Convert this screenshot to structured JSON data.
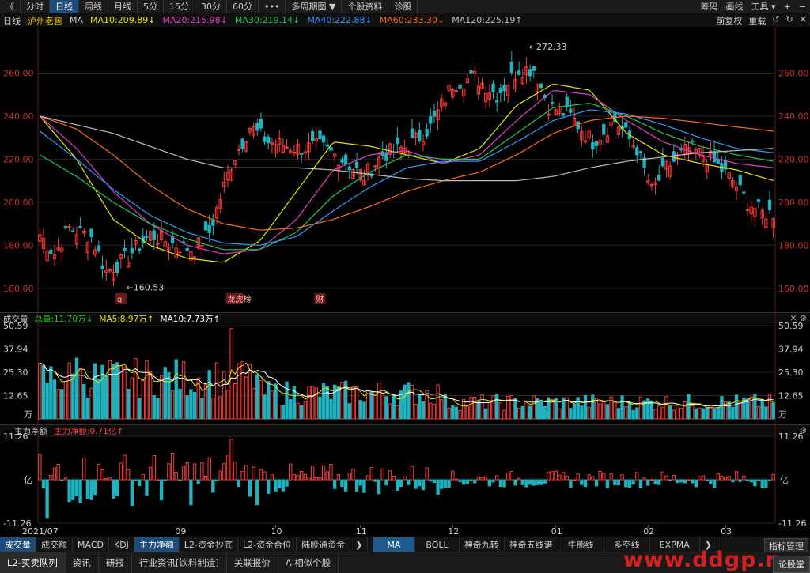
{
  "toolbar": {
    "back": "《",
    "tabs": [
      "分时",
      "日线",
      "周线",
      "月线",
      "5分",
      "15分",
      "30分",
      "60分",
      "•••",
      "多周期图 ▼",
      "个股资料",
      "诊股"
    ],
    "active_tab": 1,
    "right": [
      "筹码",
      "画线",
      "工具 ▾",
      "+",
      "−"
    ]
  },
  "ma_header": {
    "period": "日线",
    "stock": "泸州老窖",
    "ma_label": "MA",
    "items": [
      {
        "text": "MA10:209.89↓",
        "color": "#e6e600"
      },
      {
        "text": "MA20:215.98↓",
        "color": "#e040c0"
      },
      {
        "text": "MA30:219.14↓",
        "color": "#22c55e"
      },
      {
        "text": "MA40:222.88↓",
        "color": "#3399ff"
      },
      {
        "text": "MA60:233.30↓",
        "color": "#ff6a1a"
      },
      {
        "text": "MA120:225.19↑",
        "color": "#bdbdbd"
      }
    ],
    "right": [
      "前复权",
      "重载",
      "↺",
      "↻",
      "✕"
    ]
  },
  "volume_header": {
    "title": "成交量",
    "items": [
      {
        "text": "总量:11.70万↓",
        "color": "#22cc22"
      },
      {
        "text": "MA5:8.97万↑",
        "color": "#e6e600"
      },
      {
        "text": "MA10:7.73万↑",
        "color": "#ffffff"
      }
    ]
  },
  "flow_header": {
    "title": "主力净额",
    "items": [
      {
        "text": "主力净额:0.71亿↑",
        "color": "#ff4040"
      }
    ]
  },
  "chart_data": {
    "type": "candlestick",
    "title": "泸州老窖",
    "price_axis": {
      "ticks": [
        "260.00",
        "240.00",
        "220.00",
        "200.00",
        "180.00",
        "160.00"
      ],
      "ylim": [
        150,
        280
      ]
    },
    "annotations": [
      {
        "label": "272.33"
      },
      {
        "label": "160.53"
      }
    ],
    "event_marks": [
      "q",
      "龙虎榜",
      "财"
    ],
    "x_labels": [
      "2021/07",
      "09",
      "10",
      "11",
      "12",
      "01",
      "02",
      "03"
    ],
    "volume_axis": {
      "ticks": [
        "50.59",
        "37.94",
        "25.30",
        "12.65"
      ],
      "unit": "万"
    },
    "flow_axis": {
      "ticks": [
        "11.26",
        "-11.26"
      ],
      "unit": "亿"
    },
    "price_keypoints": [
      {
        "i": 0,
        "p": 185
      },
      {
        "i": 4,
        "p": 176
      },
      {
        "i": 8,
        "p": 188
      },
      {
        "i": 14,
        "p": 184
      },
      {
        "i": 18,
        "p": 168
      },
      {
        "i": 22,
        "p": 172
      },
      {
        "i": 30,
        "p": 185
      },
      {
        "i": 37,
        "p": 180
      },
      {
        "i": 42,
        "p": 178
      },
      {
        "i": 46,
        "p": 186
      },
      {
        "i": 52,
        "p": 218
      },
      {
        "i": 57,
        "p": 235
      },
      {
        "i": 62,
        "p": 228
      },
      {
        "i": 70,
        "p": 225
      },
      {
        "i": 76,
        "p": 226
      },
      {
        "i": 82,
        "p": 220
      },
      {
        "i": 88,
        "p": 212
      },
      {
        "i": 93,
        "p": 222
      },
      {
        "i": 100,
        "p": 226
      },
      {
        "i": 106,
        "p": 235
      },
      {
        "i": 112,
        "p": 255
      },
      {
        "i": 118,
        "p": 258
      },
      {
        "i": 124,
        "p": 250
      },
      {
        "i": 130,
        "p": 262
      },
      {
        "i": 134,
        "p": 262
      },
      {
        "i": 138,
        "p": 245
      },
      {
        "i": 144,
        "p": 240
      },
      {
        "i": 150,
        "p": 228
      },
      {
        "i": 156,
        "p": 238
      },
      {
        "i": 162,
        "p": 225
      },
      {
        "i": 166,
        "p": 205
      },
      {
        "i": 170,
        "p": 216
      },
      {
        "i": 176,
        "p": 225
      },
      {
        "i": 182,
        "p": 220
      },
      {
        "i": 188,
        "p": 210
      },
      {
        "i": 192,
        "p": 200
      },
      {
        "i": 196,
        "p": 195
      }
    ],
    "moving_averages": [
      {
        "name": "MA10",
        "color": "#e6e600",
        "values": [
          240,
          220,
          192,
          180,
          174,
          172,
          182,
          205,
          228,
          226,
          222,
          218,
          225,
          245,
          255,
          252,
          232,
          222,
          218,
          215,
          210
        ]
      },
      {
        "name": "MA20",
        "color": "#e040c0",
        "values": [
          240,
          225,
          205,
          190,
          180,
          176,
          178,
          192,
          215,
          222,
          224,
          218,
          222,
          238,
          252,
          250,
          238,
          228,
          222,
          218,
          216
        ]
      },
      {
        "name": "MA30",
        "color": "#22c55e",
        "values": [
          222,
          212,
          200,
          190,
          183,
          178,
          178,
          186,
          203,
          214,
          222,
          220,
          220,
          232,
          244,
          246,
          240,
          232,
          226,
          222,
          219
        ]
      },
      {
        "name": "MA40",
        "color": "#3399ff",
        "values": [
          233,
          220,
          206,
          194,
          186,
          181,
          180,
          184,
          196,
          207,
          216,
          219,
          219,
          228,
          238,
          243,
          241,
          236,
          230,
          225,
          223
        ]
      },
      {
        "name": "MA60",
        "color": "#ff6a1a",
        "values": [
          240,
          234,
          222,
          208,
          197,
          190,
          187,
          188,
          192,
          198,
          205,
          210,
          214,
          222,
          232,
          238,
          240,
          239,
          237,
          235,
          233
        ]
      },
      {
        "name": "MA120",
        "color": "#bdbdbd",
        "values": [
          240,
          236,
          232,
          226,
          220,
          216,
          216,
          216,
          215,
          213,
          211,
          210,
          210,
          210,
          212,
          216,
          219,
          221,
          223,
          224,
          225
        ]
      }
    ]
  },
  "bottom_tabs": {
    "left": [
      "成交量",
      "成交额",
      "MACD",
      "KDJ",
      "主力净额",
      "L2-资金抄底",
      "L2-资金合位",
      "陆股通资金"
    ],
    "right": [
      "MA",
      "BOLL",
      "神奇九转",
      "神奇五线谱",
      "牛熊线",
      "多空线",
      "EXPMA"
    ],
    "side": "指标管理"
  },
  "bottom_bar": {
    "items": [
      "L2-买卖队列",
      "资讯",
      "研报",
      "行业资讯[饮料制造]",
      "关联报价",
      "AI相似个股"
    ],
    "watermark": "www.ddgp.n",
    "corner": "论股堂"
  }
}
